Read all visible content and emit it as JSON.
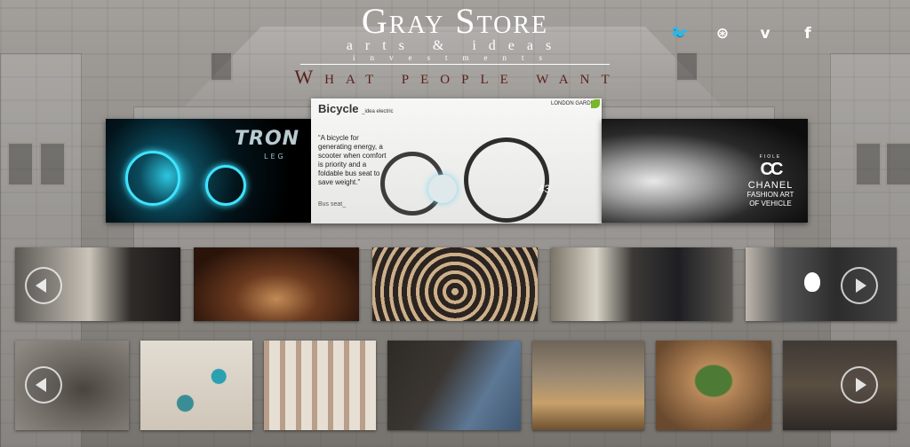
{
  "brand": {
    "name": "Gray Store",
    "line2": "arts & ideas",
    "line3": "investments",
    "tagline": "What people want"
  },
  "social": [
    {
      "name": "twitter-icon",
      "glyph": "🐦"
    },
    {
      "name": "dribbble-icon",
      "glyph": "⊛"
    },
    {
      "name": "vimeo-icon",
      "glyph": "v"
    },
    {
      "name": "facebook-icon",
      "glyph": "f"
    }
  ],
  "featured": {
    "left": {
      "title": "TRON",
      "subtitle": "LEG"
    },
    "center": {
      "title": "Bicycle",
      "subtitle": "_idea electric",
      "text": "“A bicycle for generating energy, a scooter when comfort is priority and a foldable bus seat to save weight.”",
      "caption": "Bus seat_",
      "number": "43",
      "logo": "LONDON GARDEN"
    },
    "right": {
      "brand_mark": "CC",
      "small": "FIOLE",
      "brand": "CHANEL",
      "line1": "FASHION ART",
      "line2": "OF VEHICLE"
    }
  },
  "gallery_row1": [
    "portrait",
    "theater",
    "typewriter",
    "painting",
    "apple"
  ],
  "gallery_row2": [
    "stones",
    "jewelry",
    "forest",
    "leather-case",
    "living-room",
    "cutting-board",
    "wood-craft"
  ],
  "colors": {
    "tagline": "#5b1f1a",
    "background": "#8f8c89"
  }
}
